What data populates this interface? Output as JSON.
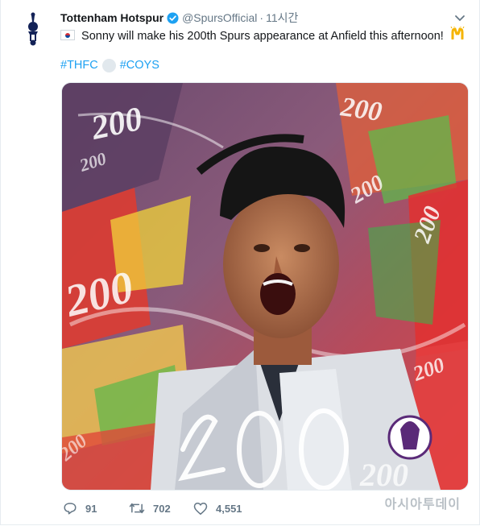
{
  "tweet": {
    "author_name": "Tottenham Hotspur",
    "handle": "@SpursOfficial",
    "separator": "·",
    "time": "11시간",
    "text": "Sonny will make his 200th Spurs appearance at Anfield this afternoon!",
    "hashtags": [
      "#THFC",
      "#COYS"
    ],
    "media_numbers": [
      "200",
      "200",
      "200",
      "200",
      "200",
      "200",
      "200",
      "200",
      "200"
    ]
  },
  "actions": {
    "replies": "91",
    "retweets": "702",
    "likes": "4,551"
  },
  "watermark": "아시아투데이",
  "icons": {
    "verified": "verified-badge-icon",
    "caret": "chevron-down-icon",
    "reply": "reply-icon",
    "retweet": "retweet-icon",
    "like": "heart-icon",
    "flag": "south-korea-flag-icon",
    "clap": "raised-hands-icon",
    "ball": "football-icon"
  },
  "colors": {
    "link": "#1da1f2",
    "secondary_text": "#657786",
    "verified": "#1da1f2",
    "spurs_navy": "#132257"
  }
}
